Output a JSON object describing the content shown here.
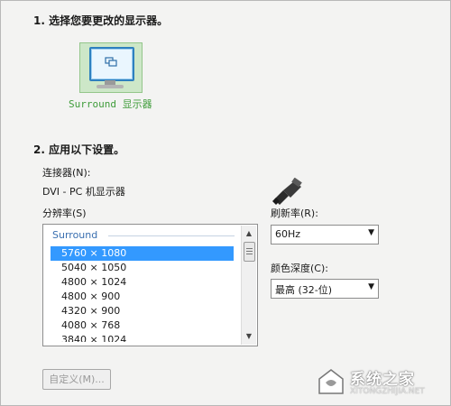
{
  "section1": {
    "title": "1. 选择您要更改的显示器。"
  },
  "monitor": {
    "label": "Surround 显示器",
    "icon": "monitor-icon"
  },
  "section2": {
    "title": "2. 应用以下设置。"
  },
  "connector": {
    "label": "连接器(N):",
    "value": "DVI - PC 机显示器",
    "icon": "dvi-connector-icon"
  },
  "resolution": {
    "label": "分辨率(S)",
    "group": "Surround",
    "items": [
      "5760 × 1080",
      "5040 × 1050",
      "4800 × 1024",
      "4800 × 900",
      "4320 × 900",
      "4080 × 768",
      "3840 × 1024"
    ],
    "selected_index": 0
  },
  "refresh": {
    "label": "刷新率(R):",
    "value": "60Hz"
  },
  "color_depth": {
    "label": "颜色深度(C):",
    "value": "最高 (32-位)"
  },
  "custom_button": {
    "label": "自定义(M)..."
  },
  "watermark": {
    "text": "系统之家",
    "url": "XITONGZHIJIA.NET"
  },
  "colors": {
    "selection": "#3399ff",
    "monitor_highlight": "#cde7c8",
    "monitor_label": "#3f9c3a"
  }
}
